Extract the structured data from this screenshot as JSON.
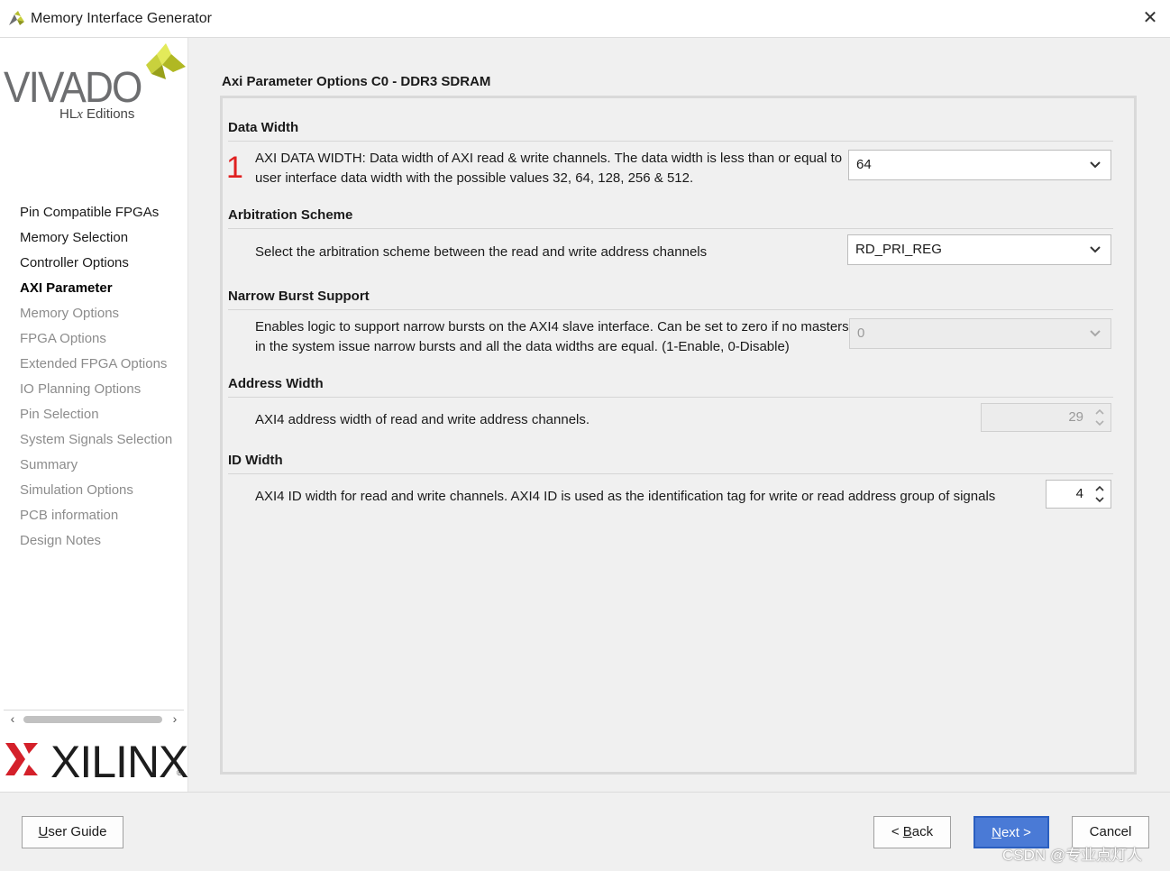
{
  "window": {
    "title": "Memory Interface Generator",
    "close_label": "✕"
  },
  "branding": {
    "vivado_word": "VIVADO",
    "vivado_sub_prefix": "HL",
    "vivado_sub_x": "x",
    "vivado_sub_suffix": " Editions",
    "xilinx_word": "XILINX",
    "xilinx_reg": "®"
  },
  "sidebar": {
    "items": [
      {
        "label": "Pin Compatible FPGAs",
        "state": "enabled"
      },
      {
        "label": "Memory Selection",
        "state": "enabled"
      },
      {
        "label": "Controller Options",
        "state": "enabled"
      },
      {
        "label": "AXI Parameter",
        "state": "active"
      },
      {
        "label": "Memory Options",
        "state": "disabled"
      },
      {
        "label": "FPGA Options",
        "state": "disabled"
      },
      {
        "label": "Extended FPGA Options",
        "state": "disabled"
      },
      {
        "label": "IO Planning Options",
        "state": "disabled"
      },
      {
        "label": "Pin Selection",
        "state": "disabled"
      },
      {
        "label": "System Signals Selection",
        "state": "disabled"
      },
      {
        "label": "Summary",
        "state": "disabled"
      },
      {
        "label": "Simulation Options",
        "state": "disabled"
      },
      {
        "label": "PCB information",
        "state": "disabled"
      },
      {
        "label": "Design Notes",
        "state": "disabled"
      }
    ],
    "scroll_left": "‹",
    "scroll_right": "›"
  },
  "main": {
    "title": "Axi Parameter Options C0 - DDR3 SDRAM",
    "sections": {
      "data_width": {
        "heading": "Data Width",
        "marker": "1",
        "line1": "AXI DATA WIDTH: Data width of AXI read & write channels. The data width is less than or equal to",
        "line2": "user interface data width with the possible values 32, 64, 128, 256 & 512.",
        "value": "64"
      },
      "arbitration": {
        "heading": "Arbitration Scheme",
        "line1": "Select the arbitration scheme between the read and write address channels",
        "value": "RD_PRI_REG"
      },
      "narrow_burst": {
        "heading": "Narrow Burst Support",
        "line1": "Enables logic to support narrow bursts on the AXI4 slave interface. Can be set to zero if no masters",
        "line2": "in the system issue narrow bursts and all the data widths are equal. (1-Enable, 0-Disable)",
        "value": "0"
      },
      "address_width": {
        "heading": "Address Width",
        "line1": "AXI4 address width of read and write address channels.",
        "value": "29"
      },
      "id_width": {
        "heading": "ID Width",
        "line1": "AXI4 ID width for read and write channels. AXI4 ID is used as the identification tag for write or read address group of signals",
        "value": "4"
      }
    }
  },
  "footer": {
    "user_guide": {
      "underlined": "U",
      "rest": "ser Guide"
    },
    "back": {
      "prefix": "< ",
      "underlined": "B",
      "rest": "ack"
    },
    "next": {
      "underlined": "N",
      "rest": "ext >"
    },
    "cancel": "Cancel"
  },
  "watermark": "CSDN @专业点灯人",
  "colors": {
    "accent_blue": "#4a7ad6",
    "marker_red": "#e02020",
    "disabled_text": "#8c8c8c"
  }
}
